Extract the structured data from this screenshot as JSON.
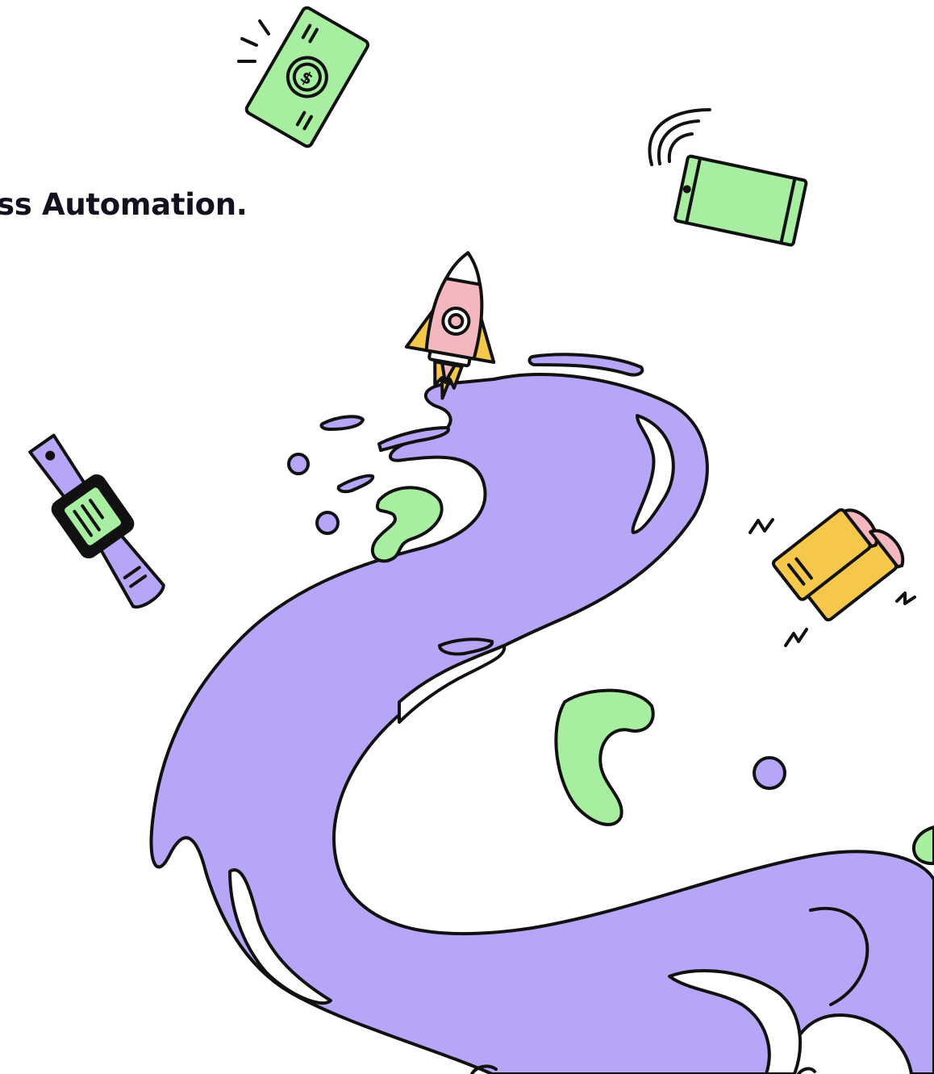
{
  "hero": {
    "headline": "ss Automation."
  },
  "illustration": {
    "colors": {
      "purple": "#b7a6f7",
      "green": "#a8eea0",
      "pink": "#f2b8bd",
      "yellow": "#f5c84c",
      "outline": "#111111"
    },
    "icons": [
      "money-bill-icon",
      "phone-icon",
      "rocket-icon",
      "smartwatch-icon",
      "books-icon"
    ]
  }
}
